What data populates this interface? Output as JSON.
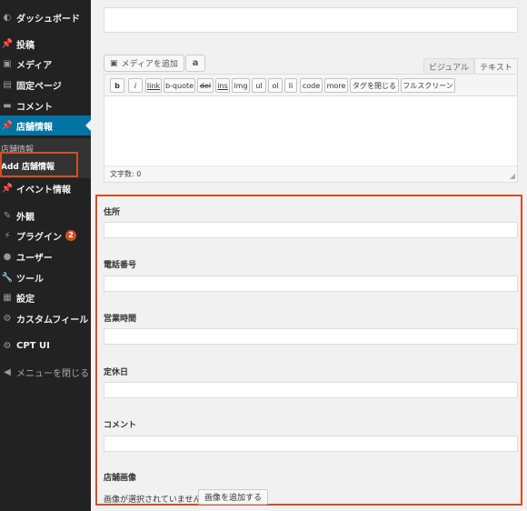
{
  "sidebar": {
    "items": [
      {
        "label": "ダッシュボード",
        "icon": "dashboard-icon"
      },
      {
        "label": "投稿",
        "icon": "pin-icon"
      },
      {
        "label": "メディア",
        "icon": "media-icon"
      },
      {
        "label": "固定ページ",
        "icon": "page-icon"
      },
      {
        "label": "コメント",
        "icon": "comment-icon"
      },
      {
        "label": "店舗情報",
        "icon": "pin-icon"
      },
      {
        "label": "イベント情報",
        "icon": "pin-icon"
      },
      {
        "label": "外観",
        "icon": "brush-icon"
      },
      {
        "label": "プラグイン",
        "icon": "plugin-icon",
        "badge": "2"
      },
      {
        "label": "ユーザー",
        "icon": "user-icon"
      },
      {
        "label": "ツール",
        "icon": "wrench-icon"
      },
      {
        "label": "設定",
        "icon": "settings-icon"
      },
      {
        "label": "カスタムフィールド",
        "icon": "gear-icon"
      },
      {
        "label": "CPT UI",
        "icon": "cpt-icon"
      },
      {
        "label": "メニューを閉じる",
        "icon": "collapse-icon"
      }
    ],
    "submenu": [
      "店舗情報",
      "Add 店舗情報"
    ]
  },
  "editor": {
    "add_media": "メディアを追加",
    "amazon": "a",
    "tab_visual": "ビジュアル",
    "tab_text": "テキスト",
    "quicktags": [
      "b",
      "i",
      "link",
      "b-quote",
      "del",
      "ins",
      "img",
      "ul",
      "ol",
      "li",
      "code",
      "more",
      "タグを閉じる",
      "フルスクリーン"
    ],
    "word_count": "文字数: 0"
  },
  "fields": {
    "address": "住所",
    "phone": "電話番号",
    "hours": "営業時間",
    "holiday": "定休日",
    "comment": "コメント",
    "image": "店舗画像",
    "no_image": "画像が選択されていません",
    "add_image": "画像を追加する"
  },
  "colors": {
    "sidebar_bg": "#222222",
    "active_menu": "#0074a2",
    "highlight": "#d54e21"
  }
}
